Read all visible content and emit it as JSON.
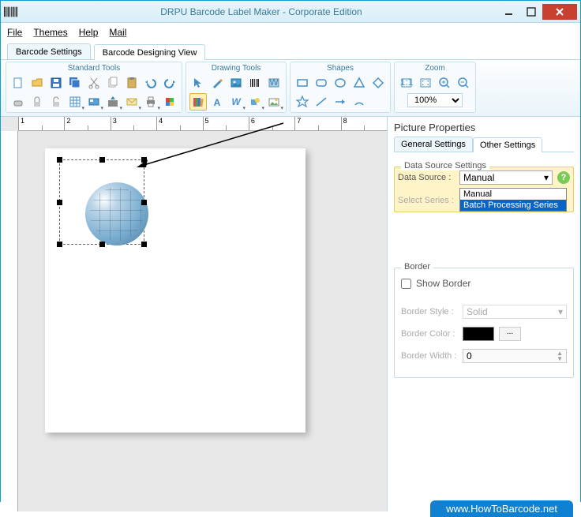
{
  "window": {
    "title": "DRPU Barcode Label Maker - Corporate Edition"
  },
  "menu": {
    "file": "File",
    "themes": "Themes",
    "help": "Help",
    "mail": "Mail"
  },
  "tabs": {
    "settings": "Barcode Settings",
    "design": "Barcode Designing View"
  },
  "ribbon": {
    "standard": "Standard Tools",
    "drawing": "Drawing Tools",
    "shapes": "Shapes",
    "zoom": "Zoom",
    "zoom_value": "100%"
  },
  "ruler": [
    "1",
    "2",
    "3",
    "4",
    "5",
    "6",
    "7",
    "8"
  ],
  "props": {
    "title": "Picture Properties",
    "tab_general": "General Settings",
    "tab_other": "Other Settings",
    "ds_legend": "Data Source Settings",
    "ds_label": "Data Source :",
    "ds_value": "Manual",
    "ds_options": [
      "Manual",
      "Batch Processing Series"
    ],
    "series_label": "Select Series :",
    "border_legend": "Border",
    "show_border": "Show Border",
    "border_style_label": "Border Style :",
    "border_style_value": "Solid",
    "border_color_label": "Border Color :",
    "border_color_btn": "...",
    "border_width_label": "Border Width :",
    "border_width_value": "0"
  },
  "footer": {
    "link": "www.HowToBarcode.net"
  }
}
